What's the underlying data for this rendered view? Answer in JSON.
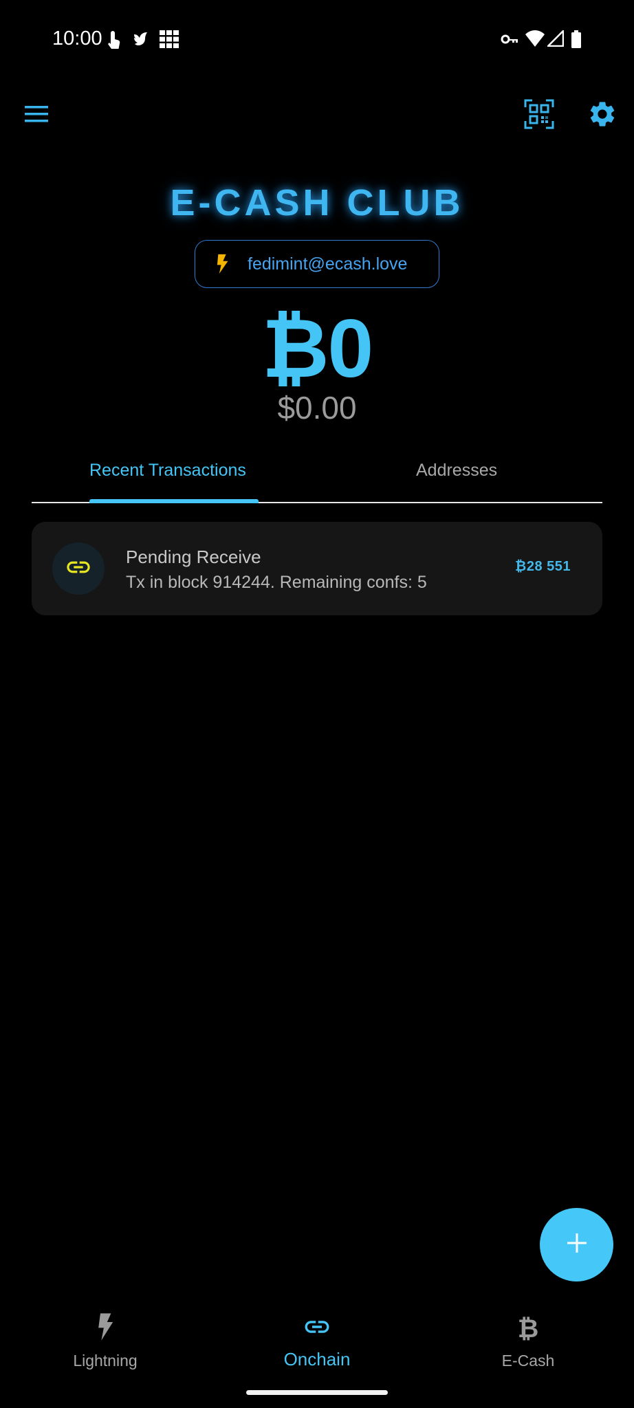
{
  "status_bar": {
    "time": "10:00",
    "left_icons": [
      "touch-icon",
      "bird-icon",
      "grid-icon"
    ],
    "right_icons": [
      "key-icon",
      "wifi-icon",
      "signal-icon",
      "battery-icon"
    ]
  },
  "app_bar": {
    "icons": [
      "menu-icon",
      "qr-scan-icon",
      "settings-icon"
    ]
  },
  "federation": {
    "name": "E-CASH CLUB",
    "lightning_address": "fedimint@ecash.love"
  },
  "balance": {
    "btc": "₿0",
    "fiat": "$0.00"
  },
  "tabs": [
    {
      "label": "Recent Transactions",
      "active": true
    },
    {
      "label": "Addresses",
      "active": false
    }
  ],
  "transactions": [
    {
      "icon": "link-icon",
      "title": "Pending Receive",
      "subtitle": "Tx in block 914244. Remaining confs: 5",
      "amount": "₿28 551"
    }
  ],
  "fab": {
    "icon": "plus-icon"
  },
  "bottom_nav": [
    {
      "label": "Lightning",
      "icon": "bolt-icon",
      "active": false
    },
    {
      "label": "Onchain",
      "icon": "link-icon",
      "active": true
    },
    {
      "label": "E-Cash",
      "icon": "bitcoin-icon",
      "active": false
    }
  ],
  "colors": {
    "accent": "#45c5f5",
    "title_glow": "#3fb6f0",
    "lightning_yellow": "#f4b400",
    "tx_icon": "#e6e622",
    "background": "#000000"
  }
}
